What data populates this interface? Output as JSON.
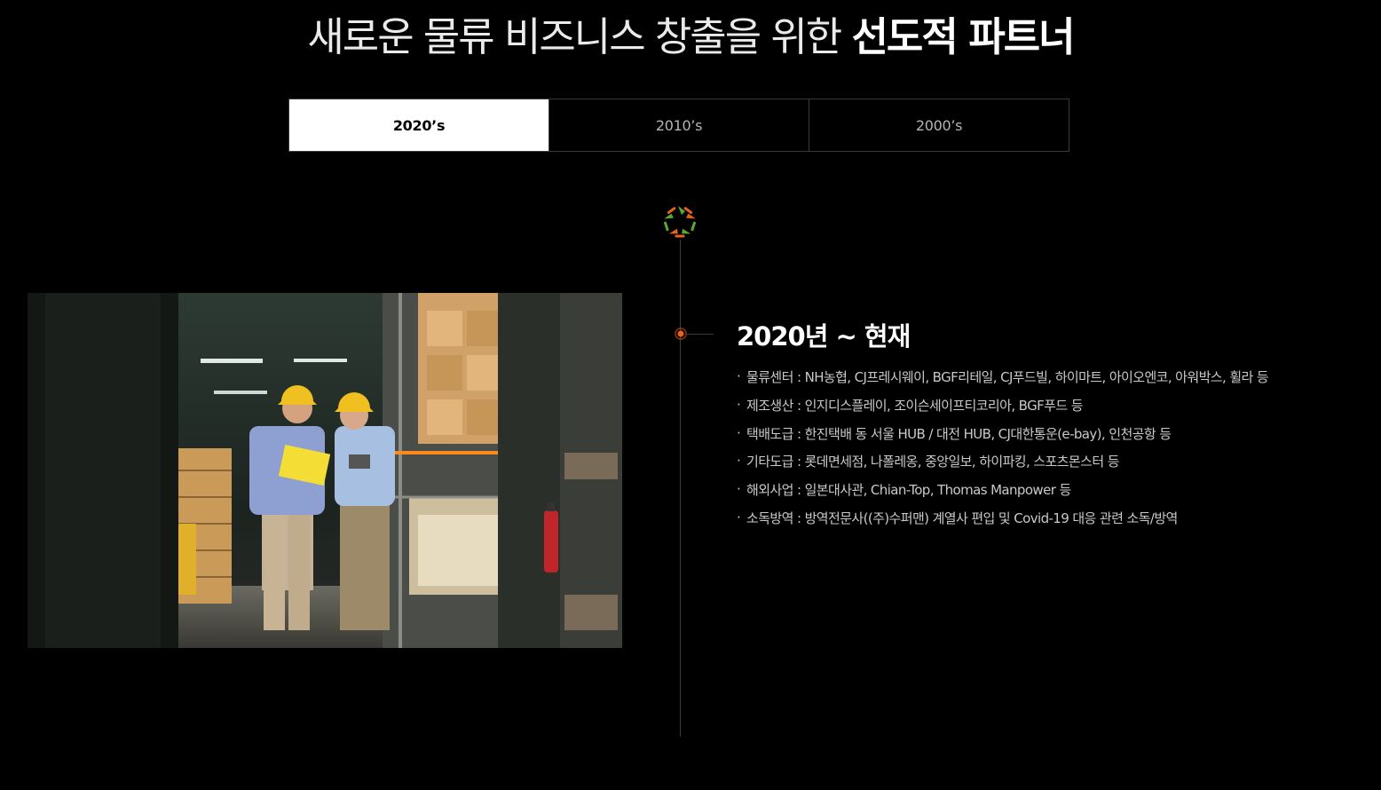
{
  "headline": {
    "light_text": "새로운 물류 비즈니스 창출을 위한 ",
    "bold_text": "선도적 파트너"
  },
  "tabs": [
    {
      "label": "2020’s",
      "active": true
    },
    {
      "label": "2010’s",
      "active": false
    },
    {
      "label": "2000’s",
      "active": false
    }
  ],
  "timeline": {
    "logo_icon": "star-burst-logo-icon",
    "accent_color": "#e8621a",
    "period_title": "2020년 ~ 현재",
    "items": [
      "물류센터 : NH농협, CJ프레시웨이, BGF리테일, CJ푸드빌, 하이마트, 아이오엔코, 아워박스, 휠라 등",
      "제조생산 : 인지디스플레이, 조이슨세이프티코리아, BGF푸드 등",
      "택배도급 : 한진택배 동 서울 HUB / 대전 HUB, CJ대한통운(e-bay), 인천공항 등",
      "기타도급 : 롯데면세점, 나폴레옹, 중앙일보, 하이파킹, 스포츠몬스터 등",
      "해외사업 : 일본대사관, Chian-Top, Thomas Manpower 등",
      "소독방역 : 방역전문사((주)수퍼맨) 계열사 편입 및 Covid-19 대응 관련 소독/방역"
    ],
    "bullet": "·"
  },
  "photo": {
    "icon": "warehouse-workers-photo"
  }
}
